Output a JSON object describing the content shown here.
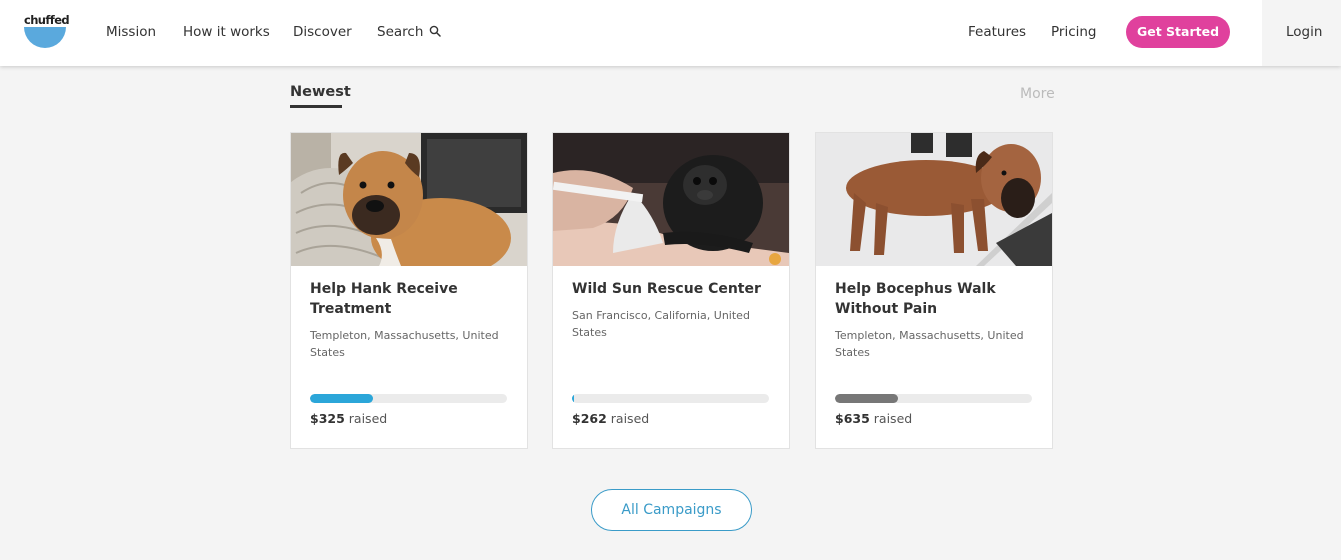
{
  "brand": {
    "logo_text": "chuffed"
  },
  "nav": {
    "mission": "Mission",
    "how_it_works": "How it works",
    "discover": "Discover",
    "search": "Search",
    "features": "Features",
    "pricing": "Pricing",
    "get_started": "Get Started",
    "login": "Login"
  },
  "section": {
    "title": "Newest",
    "more": "More"
  },
  "campaigns": [
    {
      "title": "Help Hank Receive Treatment",
      "location": "Templeton, Massachusetts, United States",
      "amount": "$325",
      "raised_label": "raised",
      "progress": 0.32,
      "bar_color": "#2ba6d9",
      "image": "dog-photo"
    },
    {
      "title": "Wild Sun Rescue Center",
      "location": "San Francisco, California, United States",
      "amount": "$262",
      "raised_label": "raised",
      "progress": 0.01,
      "bar_color": "#2ba6d9",
      "image": "monkey-photo"
    },
    {
      "title": "Help Bocephus Walk Without Pain",
      "location": "Templeton, Massachusetts, United States",
      "amount": "$635",
      "raised_label": "raised",
      "progress": 0.32,
      "bar_color": "#777777",
      "image": "dog-photo"
    }
  ],
  "all_campaigns": "All Campaigns",
  "colors": {
    "accent_pink": "#e0419d",
    "accent_blue": "#3a9bc8",
    "logo_blue": "#5aa9dd"
  }
}
